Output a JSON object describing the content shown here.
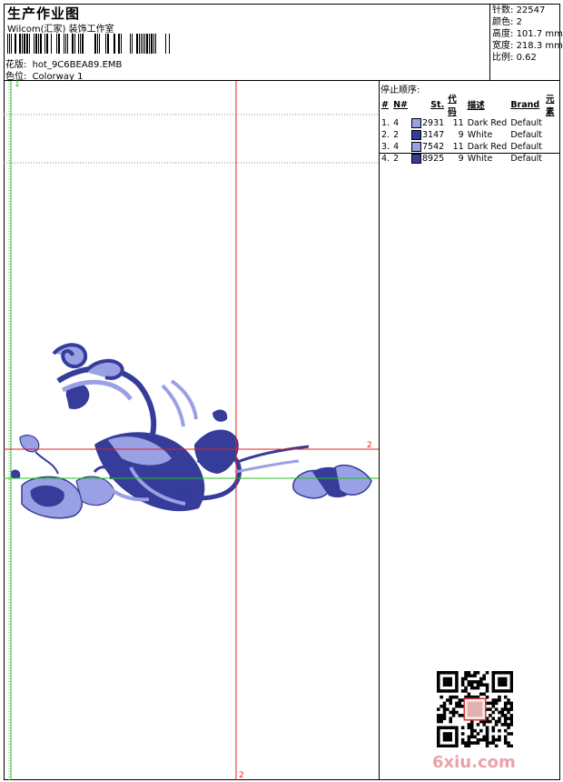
{
  "header": {
    "title": "生产作业图",
    "subtitle": "Wilcom(汇家) 装饰工作室",
    "design_label": "花版:",
    "design_value": "hot_9C6BEA89.EMB",
    "colorway_label": "色位:",
    "colorway_value": "Colorway 1"
  },
  "stats": [
    {
      "label": "针数:",
      "value": "22547"
    },
    {
      "label": "颜色:",
      "value": "2"
    },
    {
      "label": "高度:",
      "value": "101.7 mm"
    },
    {
      "label": "宽度:",
      "value": "218.3 mm"
    },
    {
      "label": "比例:",
      "value": "0.62"
    }
  ],
  "stop_sequence": {
    "title": "停止顺序:",
    "columns": [
      "#",
      "N#",
      "St.",
      "代码",
      "描述",
      "Brand",
      "元素"
    ],
    "rows": [
      {
        "idx": "1.",
        "n": "4",
        "color": "#9aa0e4",
        "st": "2931",
        "code": "11",
        "desc": "Dark Red",
        "brand": "Default"
      },
      {
        "idx": "2.",
        "n": "2",
        "color": "#353c9a",
        "st": "3147",
        "code": "9",
        "desc": "White",
        "brand": "Default"
      },
      {
        "idx": "3.",
        "n": "4",
        "color": "#9aa0e4",
        "st": "7542",
        "code": "11",
        "desc": "Dark Red",
        "brand": "Default"
      },
      {
        "idx": "4.",
        "n": "2",
        "color": "#353c9a",
        "st": "8925",
        "code": "9",
        "desc": "White",
        "brand": "Default"
      }
    ]
  },
  "guides": {
    "green_vertical_label": "1",
    "red_horizontal_label": "2",
    "red_vertical_label": "2"
  },
  "watermark": "6xiu.com",
  "colors": {
    "light_thread": "#9aa0e4",
    "dark_thread": "#353c9a",
    "guide_red": "#e02020",
    "guide_green": "#22c022"
  }
}
